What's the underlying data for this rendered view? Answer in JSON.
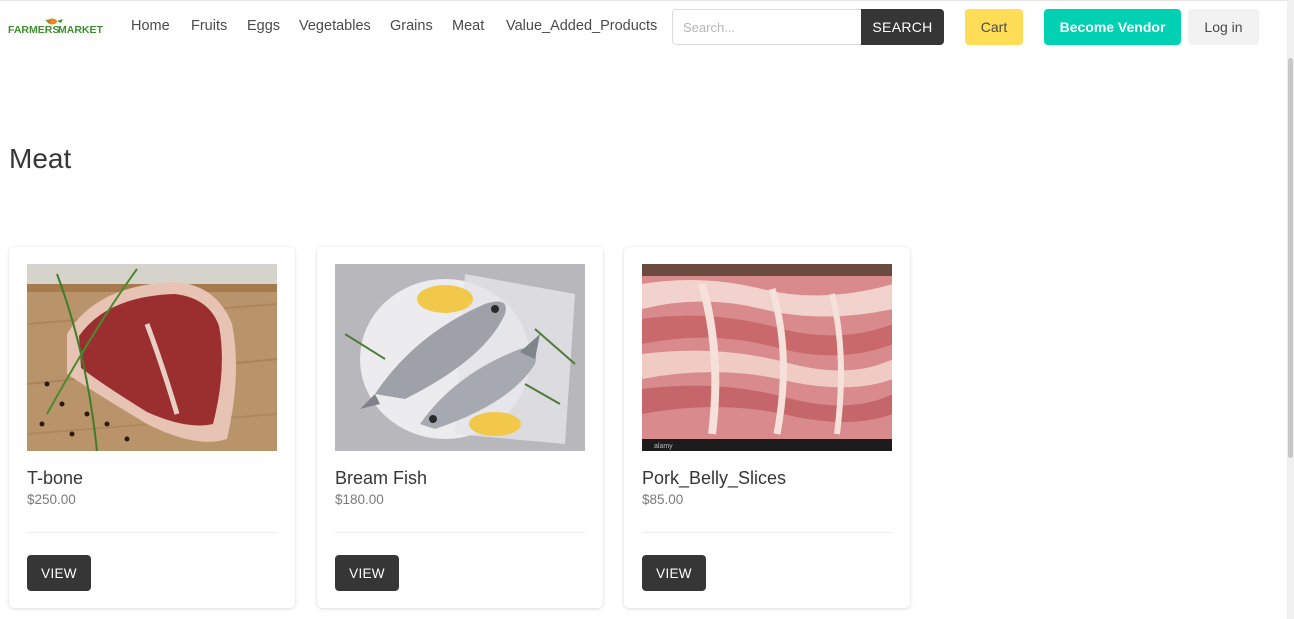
{
  "brand": {
    "logo_text": "FARMERS MARKET",
    "colors": {
      "logo_green": "#3f8f2f",
      "logo_orange": "#e8862a"
    }
  },
  "nav": {
    "items": [
      {
        "label": "Home"
      },
      {
        "label": "Fruits"
      },
      {
        "label": "Eggs"
      },
      {
        "label": "Vegetables"
      },
      {
        "label": "Grains"
      },
      {
        "label": "Meat"
      },
      {
        "label": "Value_Added_Products"
      }
    ]
  },
  "search": {
    "placeholder": "Search...",
    "value": "",
    "button_label": "SEARCH"
  },
  "actions": {
    "cart_label": "Cart",
    "vendor_label": "Become Vendor",
    "login_label": "Log in",
    "colors": {
      "cart": "#ffdd57",
      "vendor": "#00d1b2",
      "login": "#f2f2f2",
      "dark": "#363636"
    }
  },
  "page": {
    "title": "Meat"
  },
  "products": [
    {
      "name": "T-bone",
      "price": "$250.00",
      "button_label": "VIEW",
      "image": "t-bone-steak-image"
    },
    {
      "name": "Bream Fish",
      "price": "$180.00",
      "button_label": "VIEW",
      "image": "bream-fish-image"
    },
    {
      "name": "Pork_Belly_Slices",
      "price": "$85.00",
      "button_label": "VIEW",
      "image": "pork-belly-image"
    }
  ]
}
